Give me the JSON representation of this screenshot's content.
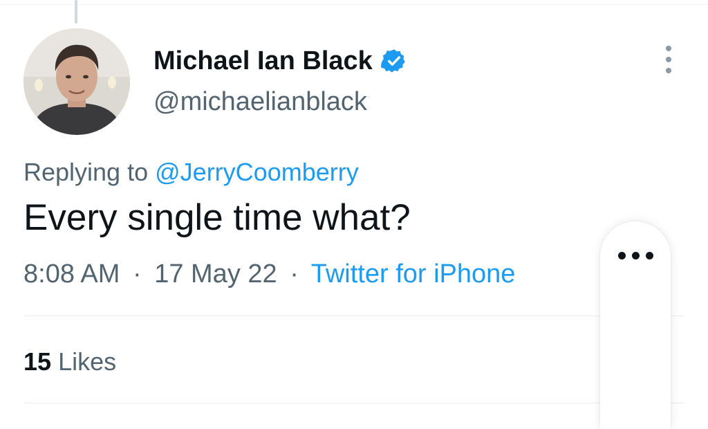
{
  "author": {
    "display_name": "Michael Ian Black",
    "handle": "@michaelianblack",
    "verified": true
  },
  "reply": {
    "prefix": "Replying to",
    "mention": "@JerryCoomberry"
  },
  "tweet": {
    "text": "Every single time what?",
    "time": "8:08 AM",
    "separator": "·",
    "date": "17 May 22",
    "source": "Twitter for iPhone"
  },
  "stats": {
    "likes_count": "15",
    "likes_label": "Likes"
  },
  "icons": {
    "verified": "verified-badge-icon",
    "more": "more-vertical-icon",
    "floating_more": "more-horizontal-icon"
  },
  "colors": {
    "link": "#1d9bf0",
    "secondary_text": "#536471",
    "primary_text": "#0f1419"
  }
}
